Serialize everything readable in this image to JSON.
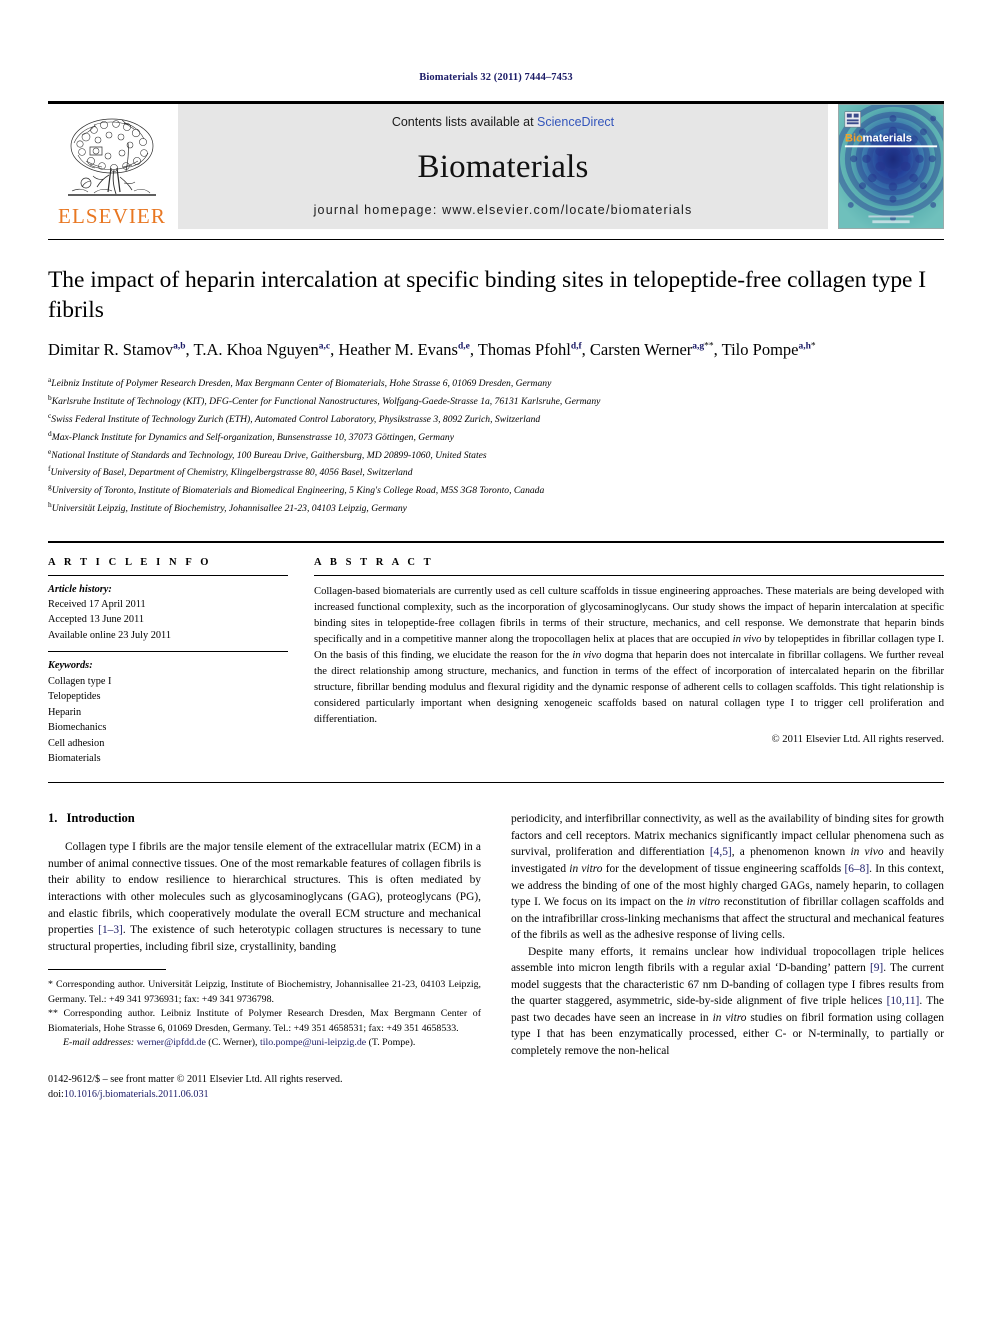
{
  "running_head": "Biomaterials 32 (2011) 7444–7453",
  "masthead": {
    "publisher_name": "ELSEVIER",
    "contents_prefix": "Contents lists available at ",
    "contents_link": "ScienceDirect",
    "journal_name": "Biomaterials",
    "homepage": "journal homepage: www.elsevier.com/locate/biomaterials",
    "cover": {
      "title_part1": "Bio",
      "title_part2": "materials",
      "color_teal": "#5fb3b0",
      "color_deep_blue": "#1b2a7a",
      "color_orange": "#f3a12a"
    },
    "colors": {
      "elsevier_orange": "#E87722",
      "band_gray": "#e6e6e6",
      "link_blue": "#3355bb"
    }
  },
  "title": "The impact of heparin intercalation at specific binding sites in telopeptide-free collagen type I fibrils",
  "authors": [
    {
      "name": "Dimitar R. Stamov",
      "sup": "a,b"
    },
    {
      "name": "T.A. Khoa Nguyen",
      "sup": "a,c"
    },
    {
      "name": "Heather M. Evans",
      "sup": "d,e"
    },
    {
      "name": "Thomas Pfohl",
      "sup": "d,f"
    },
    {
      "name": "Carsten Werner",
      "sup": "a,g",
      "star": "**"
    },
    {
      "name": "Tilo Pompe",
      "sup": "a,h",
      "star": "*"
    }
  ],
  "affiliations": [
    {
      "mark": "a",
      "text": "Leibniz Institute of Polymer Research Dresden, Max Bergmann Center of Biomaterials, Hohe Strasse 6, 01069 Dresden, Germany"
    },
    {
      "mark": "b",
      "text": "Karlsruhe Institute of Technology (KIT), DFG-Center for Functional Nanostructures, Wolfgang-Gaede-Strasse 1a, 76131 Karlsruhe, Germany"
    },
    {
      "mark": "c",
      "text": "Swiss Federal Institute of Technology Zurich (ETH), Automated Control Laboratory, Physikstrasse 3, 8092 Zurich, Switzerland"
    },
    {
      "mark": "d",
      "text": "Max-Planck Institute for Dynamics and Self-organization, Bunsenstrasse 10, 37073 Göttingen, Germany"
    },
    {
      "mark": "e",
      "text": "National Institute of Standards and Technology, 100 Bureau Drive, Gaithersburg, MD 20899-1060, United States"
    },
    {
      "mark": "f",
      "text": "University of Basel, Department of Chemistry, Klingelbergstrasse 80, 4056 Basel, Switzerland"
    },
    {
      "mark": "g",
      "text": "University of Toronto, Institute of Biomaterials and Biomedical Engineering, 5 King's College Road, M5S 3G8 Toronto, Canada"
    },
    {
      "mark": "h",
      "text": "Universität Leipzig, Institute of Biochemistry, Johannisallee 21-23, 04103 Leipzig, Germany"
    }
  ],
  "article_info": {
    "heading": "A R T I C L E   I N F O",
    "history_label": "Article history:",
    "history": [
      "Received 17 April 2011",
      "Accepted 13 June 2011",
      "Available online 23 July 2011"
    ],
    "keywords_label": "Keywords:",
    "keywords": [
      "Collagen type I",
      "Telopeptides",
      "Heparin",
      "Biomechanics",
      "Cell adhesion",
      "Biomaterials"
    ]
  },
  "abstract": {
    "heading": "A B S T R A C T",
    "text_part1": "Collagen-based biomaterials are currently used as cell culture scaffolds in tissue engineering approaches. These materials are being developed with increased functional complexity, such as the incorporation of glycosaminoglycans. Our study shows the impact of heparin intercalation at specific binding sites in telopeptide-free collagen fibrils in terms of their structure, mechanics, and cell response. We demonstrate that heparin binds specifically and in a competitive manner along the tropocollagen helix at places that are occupied ",
    "italic1": "in vivo",
    "text_part2": " by telopeptides in fibrillar collagen type I. On the basis of this finding, we elucidate the reason for the ",
    "italic2": "in vivo",
    "text_part3": " dogma that heparin does not intercalate in fibrillar collagens. We further reveal the direct relationship among structure, mechanics, and function in terms of the effect of incorporation of intercalated heparin on the fibrillar structure, fibrillar bending modulus and flexural rigidity and the dynamic response of adherent cells to collagen scaffolds. This tight relationship is considered particularly important when designing xenogeneic scaffolds based on natural collagen type I to trigger cell proliferation and differentiation.",
    "copyright": "© 2011 Elsevier Ltd. All rights reserved."
  },
  "introduction": {
    "number": "1.",
    "heading": "Introduction",
    "para1_a": "Collagen type I fibrils are the major tensile element of the extracellular matrix (ECM) in a number of animal connective tissues. One of the most remarkable features of collagen fibrils is their ability to endow resilience to hierarchical structures. This is often mediated by interactions with other molecules such as glycosaminoglycans (GAG), proteoglycans (PG), and elastic fibrils, which cooperatively modulate the overall ECM structure and mechanical properties ",
    "ref1": "[1–3]",
    "para1_b": ". The existence of such heterotypic collagen structures is necessary to tune structural properties, including fibril size, crystallinity, banding periodicity, and interfibrillar connectivity, as well as the availability of binding sites for growth factors and cell receptors. Matrix mechanics significantly impact cellular phenomena such as survival, proliferation and differentiation ",
    "ref2": "[4,5]",
    "para1_c": ", a phenomenon known ",
    "italic_invivo": "in vivo",
    "para1_d": " and heavily investigated ",
    "italic_invitro": "in vitro",
    "para1_e": " for the development of tissue engineering scaffolds ",
    "ref3": "[6–8]",
    "para1_f": ". In this context, we address the binding of one of the most highly charged GAGs, namely heparin, to collagen type I. We focus on its impact on the ",
    "italic_invitro2": "in vitro",
    "para1_g": " reconstitution of fibrillar collagen scaffolds and on the intrafibrillar cross-linking mechanisms that affect the structural and mechanical features of the fibrils as well as the adhesive response of living cells.",
    "para2_a": "Despite many efforts, it remains unclear how individual tropocollagen triple helices assemble into micron length fibrils with a regular axial ‘D-banding’ pattern ",
    "ref4": "[9]",
    "para2_b": ". The current model suggests that the characteristic 67 nm D-banding of collagen type I fibres results from the quarter staggered, asymmetric, side-by-side alignment of five triple helices ",
    "ref5": "[10,11]",
    "para2_c": ". The past two decades have seen an increase in ",
    "italic_invitro3": "in vitro",
    "para2_d": " studies on fibril formation using collagen type I that has been enzymatically processed, either C- or N-terminally, to partially or completely remove the non-helical"
  },
  "footnotes": {
    "corr1_mark": "*",
    "corr1": " Corresponding author. Universität Leipzig, Institute of Biochemistry, Johannisallee 21-23, 04103 Leipzig, Germany. Tel.: +49 341 9736931; fax: +49 341 9736798.",
    "corr2_mark": "**",
    "corr2": " Corresponding author. Leibniz Institute of Polymer Research Dresden, Max Bergmann Center of Biomaterials, Hohe Strasse 6, 01069 Dresden, Germany. Tel.: +49 351 4658531; fax: +49 351 4658533.",
    "email_label": "E-mail addresses:",
    "email1": "werner@ipfdd.de",
    "email1_owner": " (C. Werner), ",
    "email2": "tilo.pompe@uni-leipzig.de",
    "email2_owner": " (T. Pompe)."
  },
  "footer": {
    "issn_line": "0142-9612/$ – see front matter © 2011 Elsevier Ltd. All rights reserved.",
    "doi_prefix": "doi:",
    "doi": "10.1016/j.biomaterials.2011.06.031"
  }
}
